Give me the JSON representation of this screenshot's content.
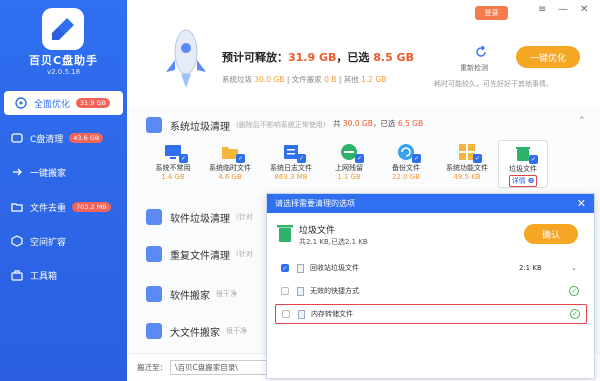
{
  "app": {
    "name": "百贝C盘助手",
    "version": "v2.0.5.18"
  },
  "sidebar": {
    "items": [
      {
        "label": "全面优化",
        "badge": "31.9 GB",
        "active": true
      },
      {
        "label": "C盘清理",
        "badge": "43.6 GB"
      },
      {
        "label": "一键搬家",
        "badge": ""
      },
      {
        "label": "文件去重",
        "badge": "703.2 MB"
      },
      {
        "label": "空间扩容",
        "badge": ""
      },
      {
        "label": "工具箱",
        "badge": ""
      }
    ]
  },
  "topbar": {
    "login": "登录",
    "menu_glyph": "≡",
    "minimize_glyph": "—",
    "close_glyph": "✕"
  },
  "summary": {
    "label1": "预计可释放：",
    "value1": "31.9 GB",
    "sep": "，已选",
    "value2": "8.5 GB",
    "sys_label": "系统垃圾",
    "sys_val": "30.0 GB",
    "move_label": "| 文件搬家",
    "move_val": "0 B",
    "dup_label": "| 其他",
    "dup_val": "1.2 GB",
    "recheck": "重新检测",
    "clean": "一键优化",
    "tip": "耗时可能较久，可先好好干其他事情。"
  },
  "categories": {
    "system": {
      "title": "系统垃圾清理",
      "desc": "(删除后不影响系统正常使用)",
      "sum_prefix": "共",
      "sum_total": "30.0 GB",
      "sum_mid": "，已选",
      "sum_sel": "6.5 GB"
    },
    "software": {
      "title": "软件垃圾清理",
      "desc": "(针对"
    },
    "dup": {
      "title": "重复文件清理",
      "desc": "(针对"
    },
    "move": {
      "title": "软件搬家",
      "desc": "很干净"
    },
    "big": {
      "title": "大文件搬家",
      "desc": "很干净"
    }
  },
  "sub_items": [
    {
      "label": "系统不常用",
      "size": "1.4 GB"
    },
    {
      "label": "系统临时文件",
      "size": "4.6 GB"
    },
    {
      "label": "系统日志文件",
      "size": "863.3 MB"
    },
    {
      "label": "上网残留",
      "size": "1.1 GB"
    },
    {
      "label": "备份文件",
      "size": "22.0 GB"
    },
    {
      "label": "系统功能文件",
      "size": "49.5 KB"
    },
    {
      "label": "垃圾文件",
      "size": "详情 ❷"
    }
  ],
  "footer": {
    "label": "搬迁至：",
    "path": "\\百贝C盘搬家目录\\",
    "tail": "选择"
  },
  "dialog": {
    "header": "请选择需要清理的选项",
    "title": "垃圾文件",
    "subtitle": "共2.1 KB,已选2.1 KB",
    "confirm": "确认",
    "options": [
      {
        "label": "回收站垃圾文件",
        "size": "2.1 KB",
        "checked": true
      },
      {
        "label": "无效的快捷方式",
        "size": "",
        "checked": false
      },
      {
        "label": "内存转储文件",
        "size": "",
        "checked": false
      }
    ]
  }
}
